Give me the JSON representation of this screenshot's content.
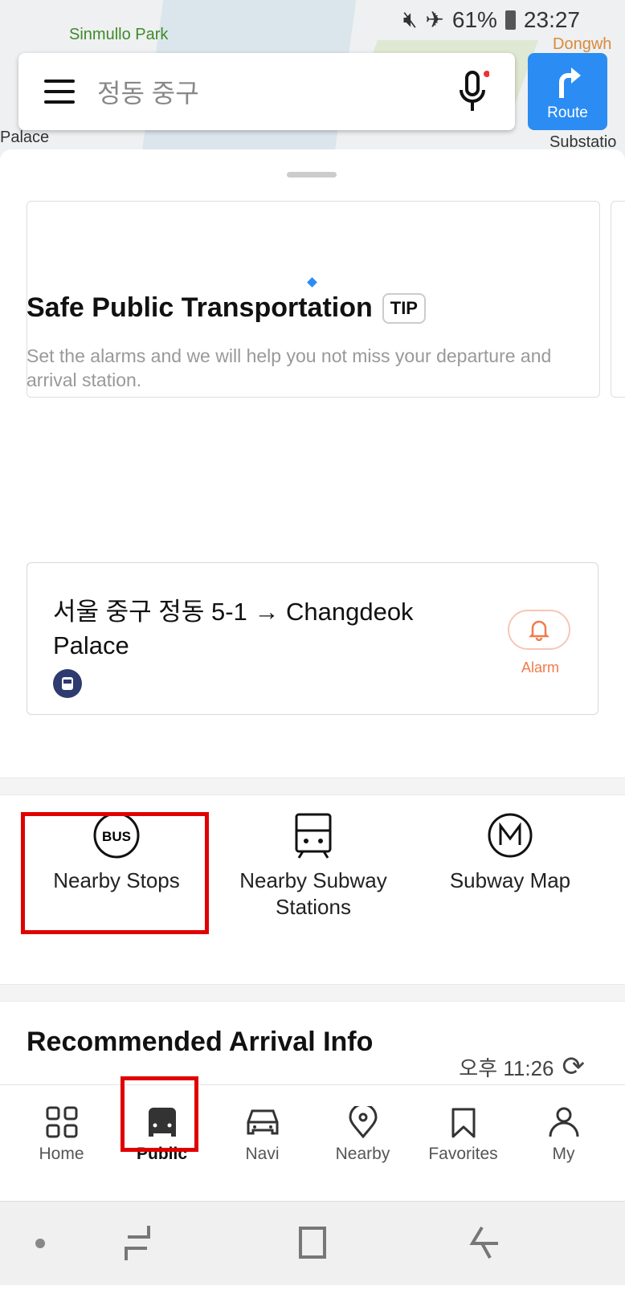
{
  "map": {
    "labels": [
      "Sinmullo Park",
      "Dongwh",
      "Palace",
      "Substatio"
    ]
  },
  "status_bar": {
    "battery": "61%",
    "time": "23:27"
  },
  "search": {
    "query": "정동 중구"
  },
  "route_button": {
    "label": "Route"
  },
  "safe_transport": {
    "title": "Safe Public Transportation",
    "tip": "TIP",
    "subtitle": "Set the alarms and we will help you not miss your departure and arrival station.",
    "route": "서울 중구 정동 5-1 → Changdeok Palace",
    "alarm_label": "Alarm"
  },
  "quick_actions": [
    {
      "label": "Nearby Stops"
    },
    {
      "label": "Nearby Subway Stations"
    },
    {
      "label": "Subway Map"
    }
  ],
  "recommended": {
    "title": "Recommended Arrival Info",
    "time": "오후 11:26"
  },
  "bottom_nav": [
    {
      "label": "Home"
    },
    {
      "label": "Public",
      "active": true
    },
    {
      "label": "Navi"
    },
    {
      "label": "Nearby"
    },
    {
      "label": "Favorites"
    },
    {
      "label": "My"
    }
  ],
  "colors": {
    "accent": "#2b8cf3",
    "alarm": "#f07b4c",
    "highlight": "#e00000"
  }
}
